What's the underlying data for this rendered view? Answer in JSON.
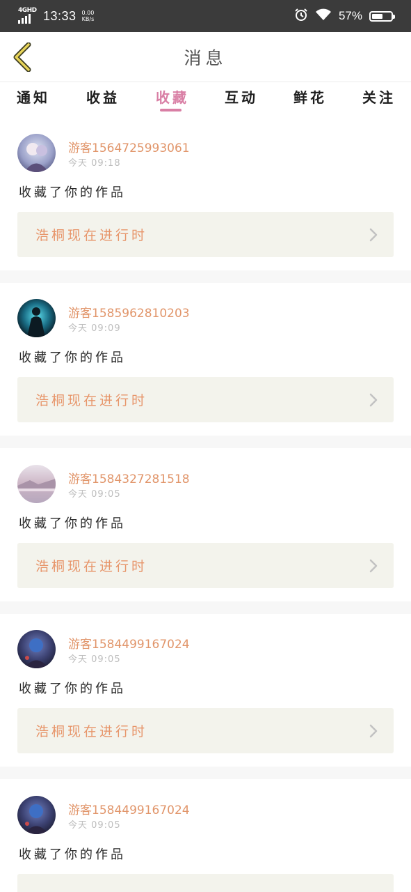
{
  "status_bar": {
    "network": "4GHD",
    "time": "13:33",
    "speed_value": "0.00",
    "speed_unit": "KB/s",
    "battery_percent": "57%",
    "battery_level": 0.57
  },
  "header": {
    "title": "消息",
    "back_icon": "chevron-left-icon"
  },
  "tabs": [
    {
      "label": "通知",
      "active": false
    },
    {
      "label": "收益",
      "active": false
    },
    {
      "label": "收藏",
      "active": true
    },
    {
      "label": "互动",
      "active": false
    },
    {
      "label": "鲜花",
      "active": false
    },
    {
      "label": "关注",
      "active": false
    }
  ],
  "messages": [
    {
      "username": "游客1564725993061",
      "time": "今天 09:18",
      "action": "收藏了你的作品",
      "work_title": "浩桐现在进行时"
    },
    {
      "username": "游客1585962810203",
      "time": "今天 09:09",
      "action": "收藏了你的作品",
      "work_title": "浩桐现在进行时"
    },
    {
      "username": "游客1584327281518",
      "time": "今天 09:05",
      "action": "收藏了你的作品",
      "work_title": "浩桐现在进行时"
    },
    {
      "username": "游客1584499167024",
      "time": "今天 09:05",
      "action": "收藏了你的作品",
      "work_title": "浩桐现在进行时"
    },
    {
      "username": "游客1584499167024",
      "time": "今天 09:05",
      "action": "收藏了你的作品",
      "work_title": ""
    }
  ],
  "colors": {
    "accent": "#d97fa5",
    "username": "#e1956a",
    "work_bg": "#f3f3ec",
    "statusbar_bg": "#3b3b3b"
  }
}
